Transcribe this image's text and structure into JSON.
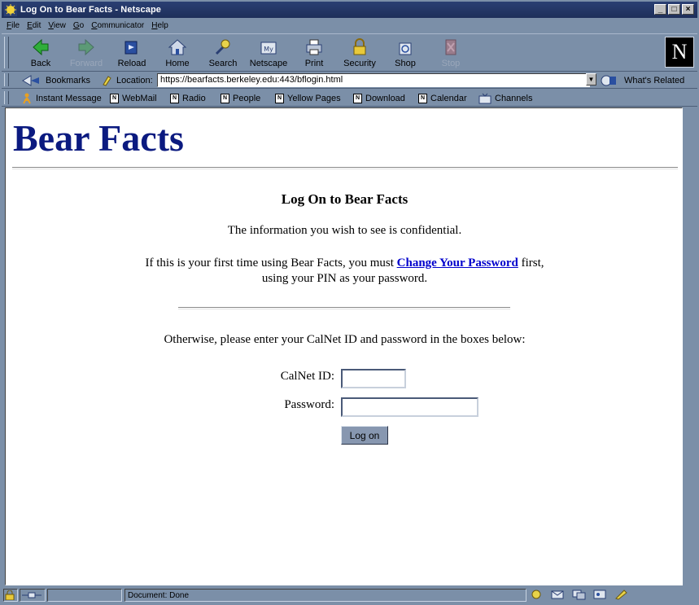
{
  "window": {
    "title": "Log On to Bear Facts - Netscape"
  },
  "menu": [
    "File",
    "Edit",
    "View",
    "Go",
    "Communicator",
    "Help"
  ],
  "nav": {
    "back": "Back",
    "forward": "Forward",
    "reload": "Reload",
    "home": "Home",
    "search": "Search",
    "netscape": "Netscape",
    "print": "Print",
    "security": "Security",
    "shop": "Shop",
    "stop": "Stop"
  },
  "location": {
    "bookmarks": "Bookmarks",
    "label": "Location:",
    "url": "https://bearfacts.berkeley.edu:443/bflogin.html",
    "related": "What's Related"
  },
  "personal": {
    "items": [
      "Instant Message",
      "WebMail",
      "Radio",
      "People",
      "Yellow Pages",
      "Download",
      "Calendar",
      "Channels"
    ]
  },
  "page": {
    "site_title": "Bear Facts",
    "heading": "Log On to Bear Facts",
    "confidential": "The information you wish to see is confidential.",
    "first_time_prefix": "If this is your first time using Bear Facts, you must ",
    "change_password_link": "Change Your Password",
    "first_time_suffix": " first,",
    "pin_note": "using your PIN as your password.",
    "otherwise": "Otherwise, please enter your CalNet ID and password in the boxes below:",
    "calnet_label": "CalNet ID:",
    "calnet_value": "",
    "password_label": "Password:",
    "password_value": "",
    "logon_button": "Log on"
  },
  "status": {
    "text": "Document: Done"
  }
}
